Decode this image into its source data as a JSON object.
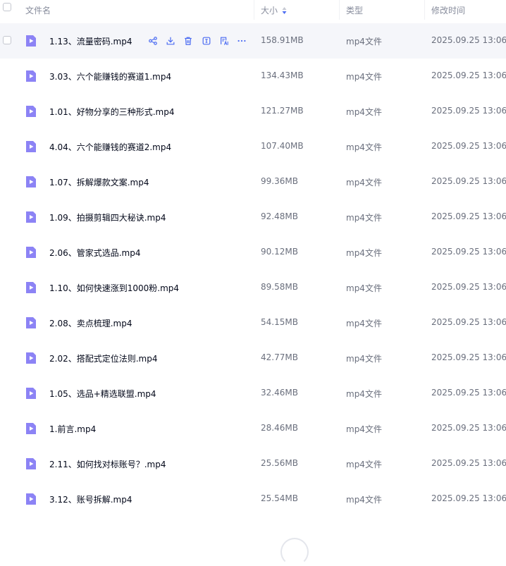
{
  "header": {
    "name_label": "文件名",
    "size_label": "大小",
    "type_label": "类型",
    "date_label": "修改时间"
  },
  "colors": {
    "accent": "#4e6ef2",
    "file_icon": "#8c83f5",
    "hover_row": "#f5f6fa"
  },
  "rows": [
    {
      "name": "1.13、流量密码.mp4",
      "size": "158.91MB",
      "type": "mp4文件",
      "date": "2025.09.25 13:06"
    },
    {
      "name": "3.03、六个能赚钱的赛道1.mp4",
      "size": "134.43MB",
      "type": "mp4文件",
      "date": "2025.09.25 13:06"
    },
    {
      "name": "1.01、好物分享的三种形式.mp4",
      "size": "121.27MB",
      "type": "mp4文件",
      "date": "2025.09.25 13:06"
    },
    {
      "name": "4.04、六个能赚钱的赛道2.mp4",
      "size": "107.40MB",
      "type": "mp4文件",
      "date": "2025.09.25 13:06"
    },
    {
      "name": "1.07、拆解爆款文案.mp4",
      "size": "99.36MB",
      "type": "mp4文件",
      "date": "2025.09.25 13:06"
    },
    {
      "name": "1.09、拍摄剪辑四大秘诀.mp4",
      "size": "92.48MB",
      "type": "mp4文件",
      "date": "2025.09.25 13:06"
    },
    {
      "name": "2.06、管家式选品.mp4",
      "size": "90.12MB",
      "type": "mp4文件",
      "date": "2025.09.25 13:06"
    },
    {
      "name": "1.10、如何快速涨到1000粉.mp4",
      "size": "89.58MB",
      "type": "mp4文件",
      "date": "2025.09.25 13:06"
    },
    {
      "name": "2.08、卖点梳理.mp4",
      "size": "54.15MB",
      "type": "mp4文件",
      "date": "2025.09.25 13:06"
    },
    {
      "name": "2.02、搭配式定位法则.mp4",
      "size": "42.77MB",
      "type": "mp4文件",
      "date": "2025.09.25 13:06"
    },
    {
      "name": "1.05、选品+精选联盟.mp4",
      "size": "32.46MB",
      "type": "mp4文件",
      "date": "2025.09.25 13:06"
    },
    {
      "name": "1.前言.mp4",
      "size": "28.46MB",
      "type": "mp4文件",
      "date": "2025.09.25 13:06"
    },
    {
      "name": "2.11、如何找对标账号？.mp4",
      "size": "25.56MB",
      "type": "mp4文件",
      "date": "2025.09.25 13:06"
    },
    {
      "name": "3.12、账号拆解.mp4",
      "size": "25.54MB",
      "type": "mp4文件",
      "date": "2025.09.25 13:06"
    }
  ],
  "row_actions": [
    "share-icon",
    "download-icon",
    "delete-icon",
    "text-extract-icon",
    "ai-summary-icon",
    "more-icon"
  ]
}
